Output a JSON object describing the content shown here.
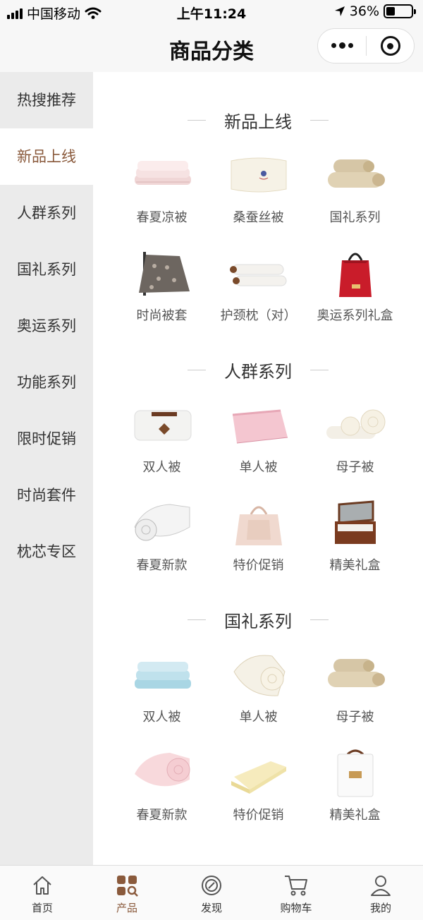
{
  "status_bar": {
    "carrier": "中国移动",
    "time": "上午11:24",
    "battery": "36%",
    "battery_level": 0.36
  },
  "nav": {
    "title": "商品分类"
  },
  "sidebar": {
    "items": [
      {
        "label": "热搜推荐"
      },
      {
        "label": "新品上线"
      },
      {
        "label": "人群系列"
      },
      {
        "label": "国礼系列"
      },
      {
        "label": "奥运系列"
      },
      {
        "label": "功能系列"
      },
      {
        "label": "限时促销"
      },
      {
        "label": "时尚套件"
      },
      {
        "label": "枕芯专区"
      }
    ],
    "active_index": 1
  },
  "sections": [
    {
      "title": "新品上线",
      "products": [
        {
          "label": "春夏凉被",
          "icon": "quilt-stack-pink"
        },
        {
          "label": "桑蚕丝被",
          "icon": "silk-quilt-cream"
        },
        {
          "label": "国礼系列",
          "icon": "rolled-quilts-beige"
        },
        {
          "label": "时尚被套",
          "icon": "throw-blanket-gray"
        },
        {
          "label": "护颈枕（对）",
          "icon": "neck-pillows"
        },
        {
          "label": "奥运系列礼盒",
          "icon": "red-gift-bag"
        }
      ]
    },
    {
      "title": "人群系列",
      "products": [
        {
          "label": "双人被",
          "icon": "quilt-white-label"
        },
        {
          "label": "单人被",
          "icon": "quilt-pink"
        },
        {
          "label": "母子被",
          "icon": "rolled-quilts-cream"
        },
        {
          "label": "春夏新款",
          "icon": "rolled-quilt-white"
        },
        {
          "label": "特价促销",
          "icon": "tote-bag"
        },
        {
          "label": "精美礼盒",
          "icon": "wooden-gift-box"
        }
      ]
    },
    {
      "title": "国礼系列",
      "products": [
        {
          "label": "双人被",
          "icon": "quilt-stack-blue"
        },
        {
          "label": "单人被",
          "icon": "rolled-quilt-ivory"
        },
        {
          "label": "母子被",
          "icon": "rolled-quilts-beige"
        },
        {
          "label": "春夏新款",
          "icon": "rolled-quilt-pink"
        },
        {
          "label": "特价促销",
          "icon": "quilt-folded-yellow"
        },
        {
          "label": "精美礼盒",
          "icon": "white-gift-box"
        }
      ]
    }
  ],
  "tab_bar": {
    "items": [
      {
        "label": "首页",
        "icon": "home-icon"
      },
      {
        "label": "产品",
        "icon": "product-grid-icon"
      },
      {
        "label": "发现",
        "icon": "discover-icon"
      },
      {
        "label": "购物车",
        "icon": "cart-icon"
      },
      {
        "label": "我的",
        "icon": "profile-icon"
      }
    ],
    "active_index": 1
  },
  "colors": {
    "accent": "#8a5a3c",
    "sidebar_bg": "#ebebeb",
    "active_tab": "#8a5a3c"
  }
}
